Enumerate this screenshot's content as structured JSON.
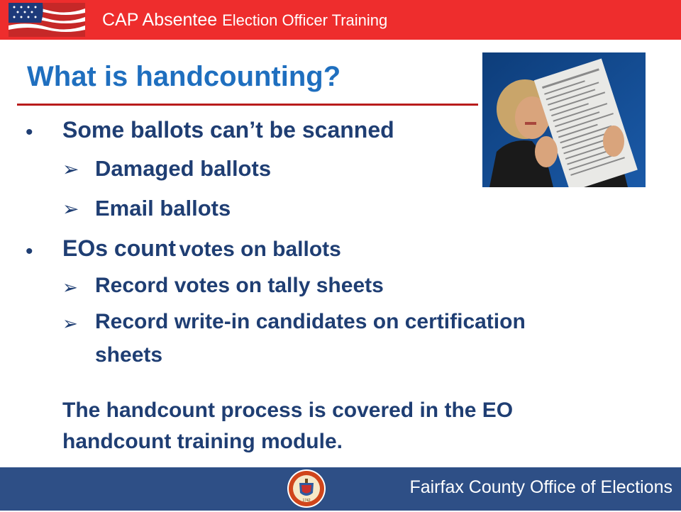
{
  "header": {
    "title_prefix": "CAP Absentee",
    "title_suffix": "Election Officer Training"
  },
  "slide": {
    "title": "What is handcounting?",
    "bullets": [
      {
        "text": "Some ballots can’t be scanned",
        "subitems": [
          "Damaged ballots",
          "Email ballots"
        ]
      },
      {
        "text_bold": "EOs count",
        "text_rest": "votes on ballots",
        "subitems": [
          "Record votes on tally sheets",
          "Record write-in candidates on certification",
          "sheets"
        ]
      }
    ],
    "note_line1": "The handcount process is covered in the EO",
    "note_line2": "handcount training module."
  },
  "footer": {
    "org": "Fairfax County Office of Elections",
    "seal_year": "1742"
  },
  "colors": {
    "header_red": "#ee2d2d",
    "title_blue": "#1f6fbf",
    "text_navy": "#1f3e73",
    "footer_blue": "#2e4f86"
  }
}
